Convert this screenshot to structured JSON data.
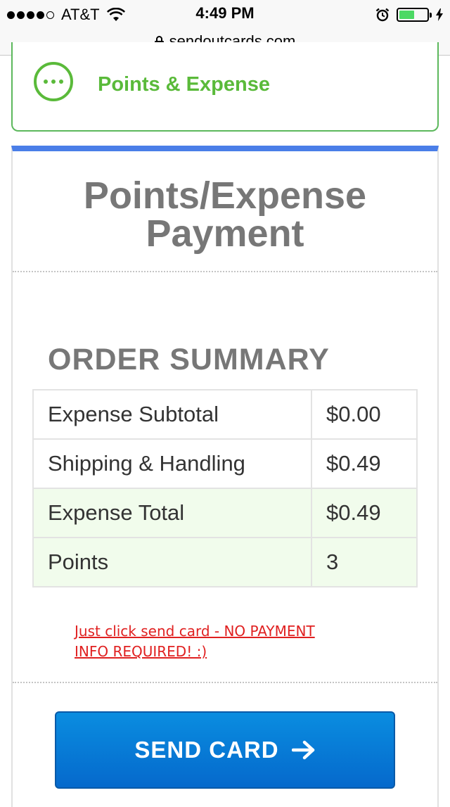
{
  "status_bar": {
    "carrier": "AT&T",
    "time": "4:49 PM",
    "signal_bars": 4,
    "battery_level": 0.55
  },
  "browser": {
    "url": "sendoutcards.com"
  },
  "section_header": {
    "icon": "more-dots-circle-icon",
    "title": "Points & Expense"
  },
  "page": {
    "title": "Points/Expense Payment"
  },
  "order_summary": {
    "heading": "ORDER SUMMARY",
    "rows": [
      {
        "label": "Expense Subtotal",
        "value": "$0.00"
      },
      {
        "label": "Shipping & Handling",
        "value": "$0.49"
      },
      {
        "label": "Expense Total",
        "value": "$0.49"
      },
      {
        "label": "Points",
        "value": "3"
      }
    ]
  },
  "note": "Just click send card - NO PAYMENT INFO REQUIRED! :)",
  "send_button": {
    "label": "SEND CARD",
    "icon": "arrow-right-icon"
  },
  "colors": {
    "accent_green": "#5aba3a",
    "top_bar_blue": "#4a7ee8",
    "button_blue": "#0a7ed8",
    "note_red": "#e02020",
    "total_row_bg": "#f1fcec"
  }
}
